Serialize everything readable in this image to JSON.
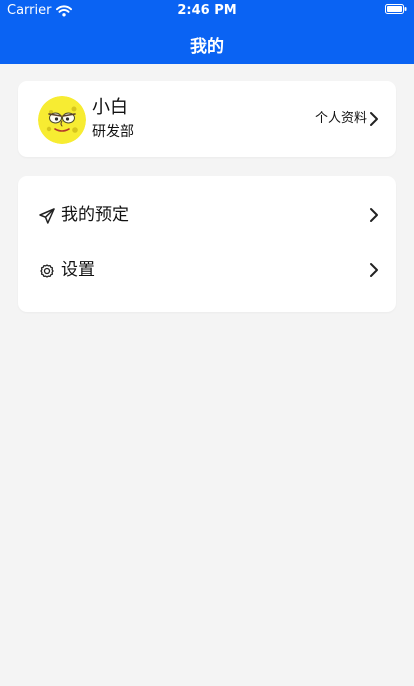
{
  "status_bar": {
    "carrier": "Carrier",
    "time": "2:46 PM",
    "wifi_icon": "wifi-icon",
    "battery_icon": "battery-icon"
  },
  "header": {
    "title": "我的",
    "background_color": "#0a63f3"
  },
  "profile": {
    "name": "小白",
    "department": "研发部",
    "link_label": "个人资料",
    "avatar_icon": "yellow-cartoon-avatar"
  },
  "menu": {
    "items": [
      {
        "label": "我的预定",
        "icon": "paper-plane-icon"
      },
      {
        "label": "设置",
        "icon": "gear-icon"
      }
    ]
  },
  "colors": {
    "page_background": "#f4f4f4",
    "card_background": "#ffffff",
    "text": "#111111",
    "accent": "#0a63f3"
  }
}
